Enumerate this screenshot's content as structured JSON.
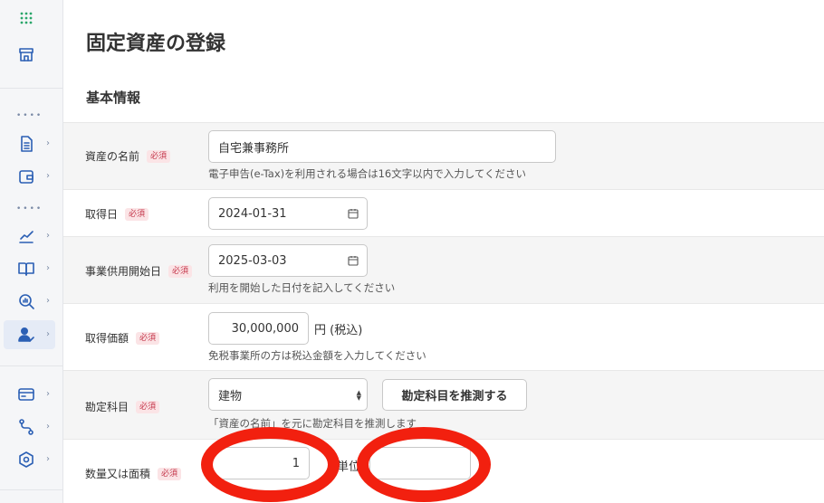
{
  "page": {
    "title": "固定資産の登録",
    "section": "基本情報"
  },
  "required_label": "必須",
  "fields": {
    "asset_name": {
      "label": "資産の名前",
      "value": "自宅兼事務所",
      "hint": "電子申告(e-Tax)を利用される場合は16文字以内で入力してください"
    },
    "acquisition_date": {
      "label": "取得日",
      "value": "2024-01-31"
    },
    "service_start_date": {
      "label": "事業供用開始日",
      "value": "2025-03-03",
      "hint": "利用を開始した日付を記入してください"
    },
    "acquisition_price": {
      "label": "取得価額",
      "value": "30,000,000",
      "unit": "円 (税込)",
      "hint": "免税事業所の方は税込金額を入力してください"
    },
    "account": {
      "label": "勘定科目",
      "value": "建物",
      "button": "勘定科目を推測する",
      "hint": "「資産の名前」を元に勘定科目を推測します"
    },
    "quantity": {
      "label": "数量又は面積",
      "value": "1",
      "unit_label": "単位",
      "unit_value": ""
    }
  },
  "colors": {
    "accent": "#2b5fb4",
    "required_bg": "#fbe4e6",
    "required_text": "#c4364a",
    "annotation": "#f2200f"
  },
  "sidebar_icons": [
    "apps-grid-icon",
    "store-icon",
    "document-icon",
    "wallet-icon",
    "chart-pen-icon",
    "book-icon",
    "search-chart-icon",
    "user-percent-icon",
    "credit-card-icon",
    "route-icon",
    "settings-hex-icon"
  ]
}
